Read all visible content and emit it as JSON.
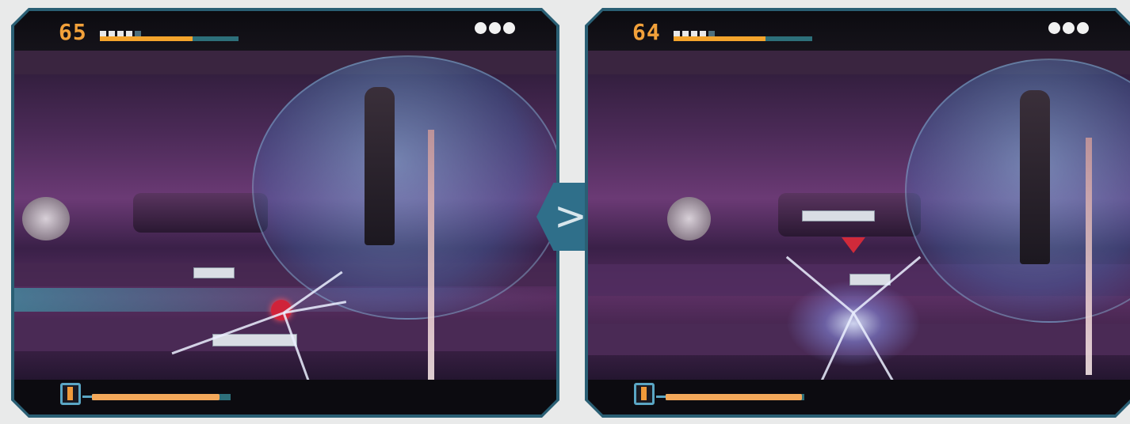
{
  "frames": [
    {
      "counter": "65",
      "health_fraction": 0.67,
      "armor_pips_filled": 4,
      "armor_pips_total": 5,
      "lives": 3,
      "ammo_fraction": 0.92
    },
    {
      "counter": "64",
      "health_fraction": 0.66,
      "armor_pips_filled": 4,
      "armor_pips_total": 5,
      "lives": 3,
      "ammo_fraction": 0.98
    }
  ],
  "arrow": {
    "symbol": ">"
  },
  "icons": {
    "ammo": "exclamation-ammo-icon",
    "lives": "life-orb-icon",
    "arrow": "next-arrow-icon"
  },
  "colors": {
    "hud_text": "#f2a13a",
    "health_fill": "#f4a42c",
    "bar_track": "#2d6f7a",
    "frame_border": "#2a5f74",
    "arrow_badge": "#2f6f8a"
  }
}
